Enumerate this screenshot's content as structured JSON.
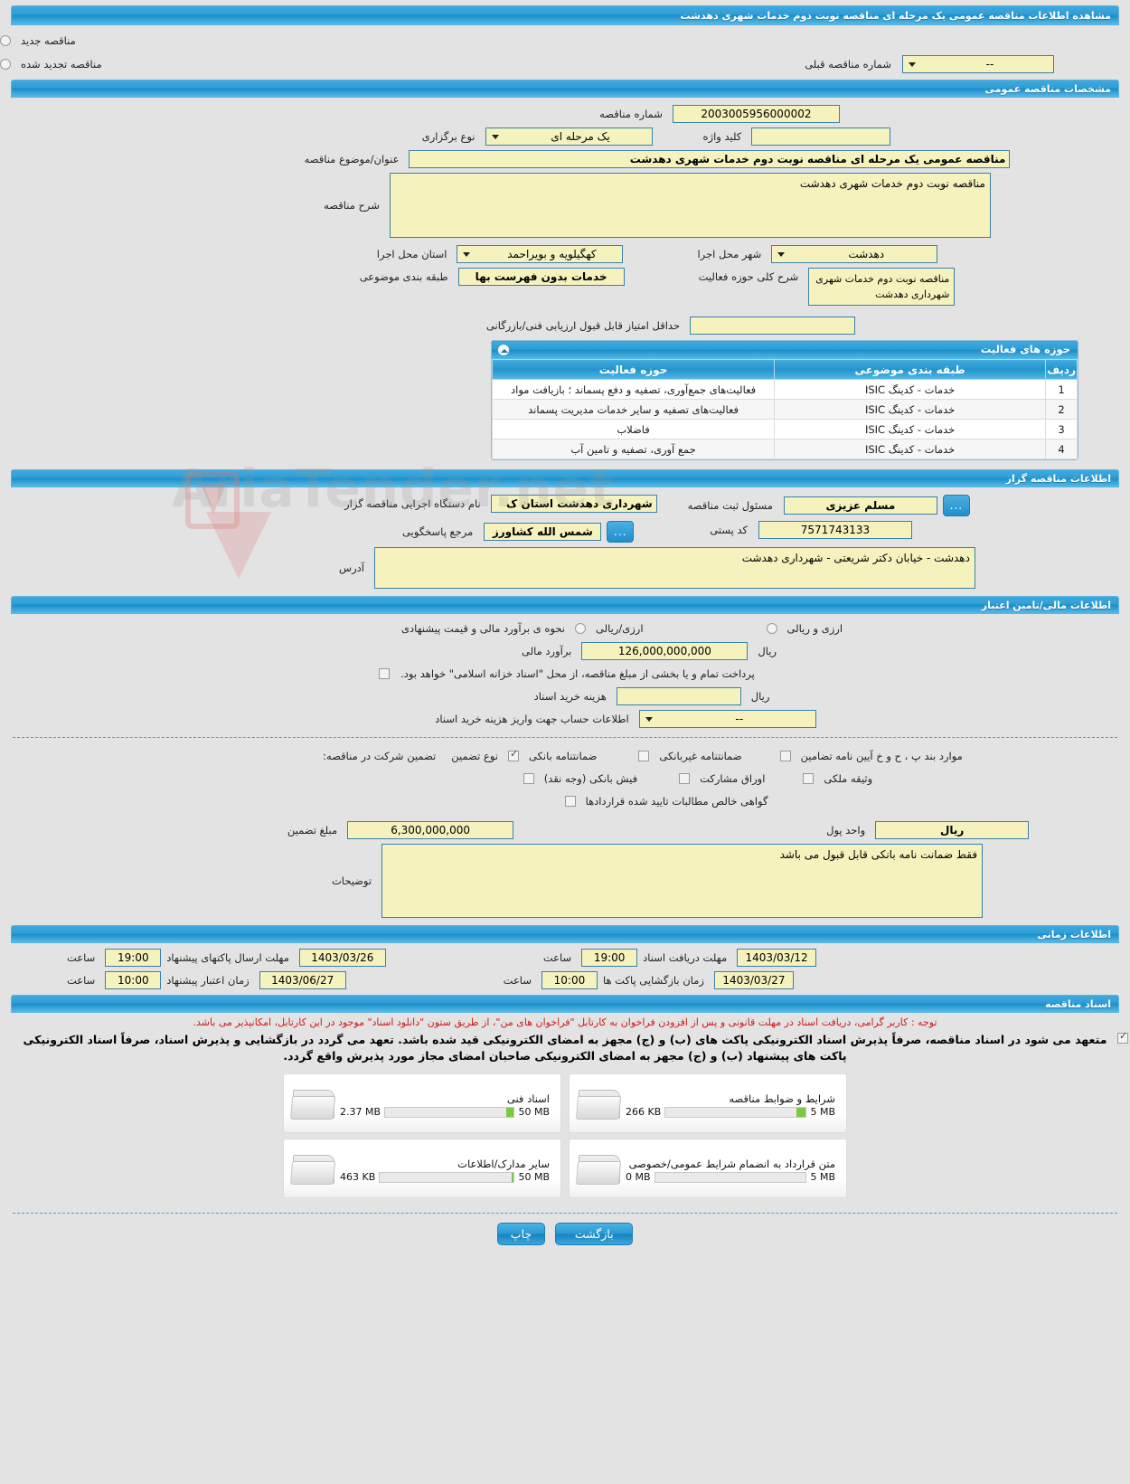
{
  "header": {
    "title": "مشاهده اطلاعات مناقصه عمومی یک مرحله ای مناقصه نوبت دوم خدمات شهری دهدشت"
  },
  "top": {
    "new_tender": "مناقصه جدید",
    "renewed_tender": "مناقصه تجدید شده",
    "prev_number_label": "شماره مناقصه قبلی",
    "prev_number_value": "--"
  },
  "general": {
    "section_title": "مشخصات مناقصه عمومی",
    "tender_no_label": "شماره مناقصه",
    "tender_no_value": "2003005956000002",
    "holding_type_label": "نوع برگزاری",
    "holding_type_value": "یک مرحله ای",
    "keyword_label": "کلید واژه",
    "keyword_value": "",
    "subject_label": "عنوان/موضوع مناقصه",
    "subject_value": "مناقصه عمومی یک مرحله ای مناقصه نوبت دوم خدمات شهری دهدشت",
    "desc_label": "شرح مناقصه",
    "desc_value": "مناقصه نوبت دوم خدمات شهری دهدشت",
    "province_label": "استان محل اجرا",
    "province_value": "کهگیلویه و بویراحمد",
    "city_label": "شهر محل اجرا",
    "city_value": "دهدشت",
    "classification_label": "طبقه بندی موضوعی",
    "classification_value": "خدمات بدون فهرست بها",
    "activity_desc_label": "شرح کلی حوزه فعالیت",
    "activity_desc_value": "مناقصه نوبت دوم خدمات شهری  شهرداری دهدشت",
    "min_score_label": "حداقل امتیاز قابل قبول ارزیابی فنی/بازرگانی",
    "min_score_value": ""
  },
  "activity_panel": {
    "title": "حوزه های فعالیت",
    "columns": [
      "ردیف",
      "طبقه بندی موضوعی",
      "حوزه فعالیت"
    ],
    "rows": [
      {
        "idx": "1",
        "classification": "خدمات - کدینگ ISIC",
        "area": "فعالیت‌های جمع‌آوری، تصفیه و دفع پسماند ؛ بازیافت مواد"
      },
      {
        "idx": "2",
        "classification": "خدمات - کدینگ ISIC",
        "area": "فعالیت‌های تصفیه و سایر خدمات مدیریت پسماند"
      },
      {
        "idx": "3",
        "classification": "خدمات - کدینگ ISIC",
        "area": "فاضلاب"
      },
      {
        "idx": "4",
        "classification": "خدمات - کدینگ ISIC",
        "area": "جمع آوری، تصفیه و تامین آب"
      }
    ]
  },
  "organizer": {
    "section_title": "اطلاعات مناقصه گزار",
    "org_name_label": "نام دستگاه اجرایی مناقصه گزار",
    "org_name_value": "شهرداری دهدشت استان ک",
    "registrar_label": "مسئول ثبت مناقصه",
    "registrar_value": "مسلم عزیزی",
    "contact_label": "مرجع پاسخگویی",
    "contact_value": "شمس الله کشاورز",
    "postal_label": "کد پستی",
    "postal_value": "7571743133",
    "address_label": "آدرس",
    "address_value": "دهدشت - خیابان دکتر شریعتی - شهرداری دهدشت",
    "dots_label": "..."
  },
  "finance": {
    "section_title": "اطلاعات مالی/تامین اعتبار",
    "estimate_mode_label": "نحوه ی برآورد مالی و قیمت پیشنهادی",
    "mode_rial": "ارزی/ریالی",
    "mode_fx_rial": "ارزی و ریالی",
    "estimate_label": "برآورد مالی",
    "estimate_value": "126,000,000,000",
    "currency_unit": "ریال",
    "treasury_note": "پرداخت تمام و یا بخشی از مبلغ مناقصه، از محل \"اسناد خزانه اسلامی\" خواهد بود.",
    "doc_cost_label": "هزینه خرید اسناد",
    "doc_cost_value": "",
    "doc_cost_unit": "ریال",
    "account_label": "اطلاعات حساب جهت واریز هزینه خرید اسناد",
    "account_value": "--"
  },
  "guarantee": {
    "participation_label": "تضمین شرکت در مناقصه:",
    "type_label": "نوع تضمین",
    "options": [
      {
        "label": "ضمانتنامه بانکی",
        "checked": true
      },
      {
        "label": "ضمانتنامه غیربانکی",
        "checked": false
      },
      {
        "label": "موارد بند پ ، ح و خ آیین نامه تضامین",
        "checked": false
      },
      {
        "label": "فیش بانکی (وجه نقد)",
        "checked": false
      },
      {
        "label": "اوراق مشارکت",
        "checked": false
      },
      {
        "label": "وثیقه ملکی",
        "checked": false
      },
      {
        "label": "گواهی خالص مطالبات تایید شده قراردادها",
        "checked": false
      }
    ],
    "amount_label": "مبلغ تضمین",
    "amount_value": "6,300,000,000",
    "money_unit_label": "واحد پول",
    "money_unit_value": "ریال",
    "notes_label": "توضیحات",
    "notes_value": "فقط ضمانت نامه بانکی قابل قبول می باشد"
  },
  "timing": {
    "section_title": "اطلاعات زمانی",
    "doc_receive_label": "مهلت دریافت اسناد",
    "doc_receive_date": "1403/03/12",
    "doc_receive_hour_label": "ساعت",
    "doc_receive_hour": "19:00",
    "submit_label": "مهلت ارسال پاکتهای پیشنهاد",
    "submit_date": "1403/03/26",
    "submit_hour_label": "ساعت",
    "submit_hour": "19:00",
    "open_label": "زمان بازگشایی پاکت ها",
    "open_date": "1403/03/27",
    "open_hour_label": "ساعت",
    "open_hour": "10:00",
    "validity_label": "زمان اعتبار پیشنهاد",
    "validity_date": "1403/06/27",
    "validity_hour_label": "ساعت",
    "validity_hour": "10:00"
  },
  "documents": {
    "section_title": "اسناد مناقصه",
    "notice_red": "توجه : کاربر گرامی، دریافت اسناد در مهلت قانونی و پس از افزودن فراخوان به کارتابل \"فراخوان های من\"، از طریق ستون \"دانلود اسناد\" موجود در این کارتابل، امکانپذیر می باشد.",
    "notice_black": "متعهد می شود در اسناد مناقصه، صرفاً پذیرش اسناد الکترونیکی پاکت های (ب) و (ج) مجهز به امضای الکترونیکی قید شده باشد. تعهد می گردد در بازگشایی و پذیرش اسناد، صرفاً اسناد الکترونیکی پاکت های پیشنهاد (ب) و (ج) مجهز به امضای الکترونیکی صاحبان امضای مجاز مورد پذیرش واقع گردد.",
    "cards": [
      {
        "title": "شرایط و ضوابط مناقصه",
        "used": "266 KB",
        "max": "5 MB",
        "fill": 7
      },
      {
        "title": "اسناد فنی",
        "used": "2.37 MB",
        "max": "50 MB",
        "fill": 6
      },
      {
        "title": "متن قرارداد به انضمام شرایط عمومی/خصوصی",
        "used": "0 MB",
        "max": "5 MB",
        "fill": 0
      },
      {
        "title": "سایر مدارک/اطلاعات",
        "used": "463 KB",
        "max": "50 MB",
        "fill": 2
      }
    ]
  },
  "footer": {
    "print_label": "چاپ",
    "back_label": "بازگشت"
  },
  "watermark": {
    "text": "AriaTender.net"
  },
  "colors": {
    "accent": "#2f9ed6",
    "field_bg": "#f5f2bd",
    "field_border": "#3a82a8",
    "page_bg": "#e3e3e3",
    "notice_red": "#d01919",
    "meter_fill": "#7ac943"
  }
}
